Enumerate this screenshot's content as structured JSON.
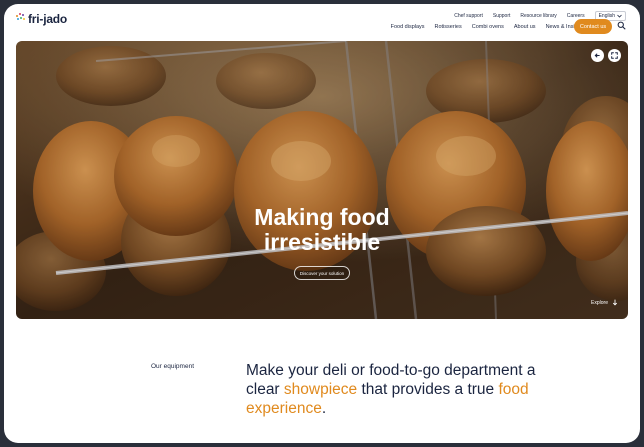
{
  "utility_links": [
    "Chef support",
    "Support",
    "Resource library",
    "Careers"
  ],
  "language": "English",
  "logo_text": "fri-jado",
  "nav": [
    "Food displays",
    "Rotisseries",
    "Combi ovens",
    "About us",
    "News & Insights"
  ],
  "cta_label": "Contact us",
  "hero": {
    "title_line1": "Making food",
    "title_line2": "irresistible",
    "discover_label": "Discover your solution",
    "explore_label": "Explore"
  },
  "section": {
    "label": "Our equipment",
    "headline_part1": "Make your deli or food-to-go department a clear ",
    "headline_hl1": "showpiece",
    "headline_part2": " that provides a true ",
    "headline_hl2": "food experience",
    "headline_part3": "."
  },
  "colors": {
    "accent": "#e08a1e",
    "navy": "#1b2540"
  },
  "icons": [
    "chevron-down-icon",
    "search-icon",
    "arrow-left-icon",
    "fullscreen-icon",
    "arrow-down-icon"
  ]
}
